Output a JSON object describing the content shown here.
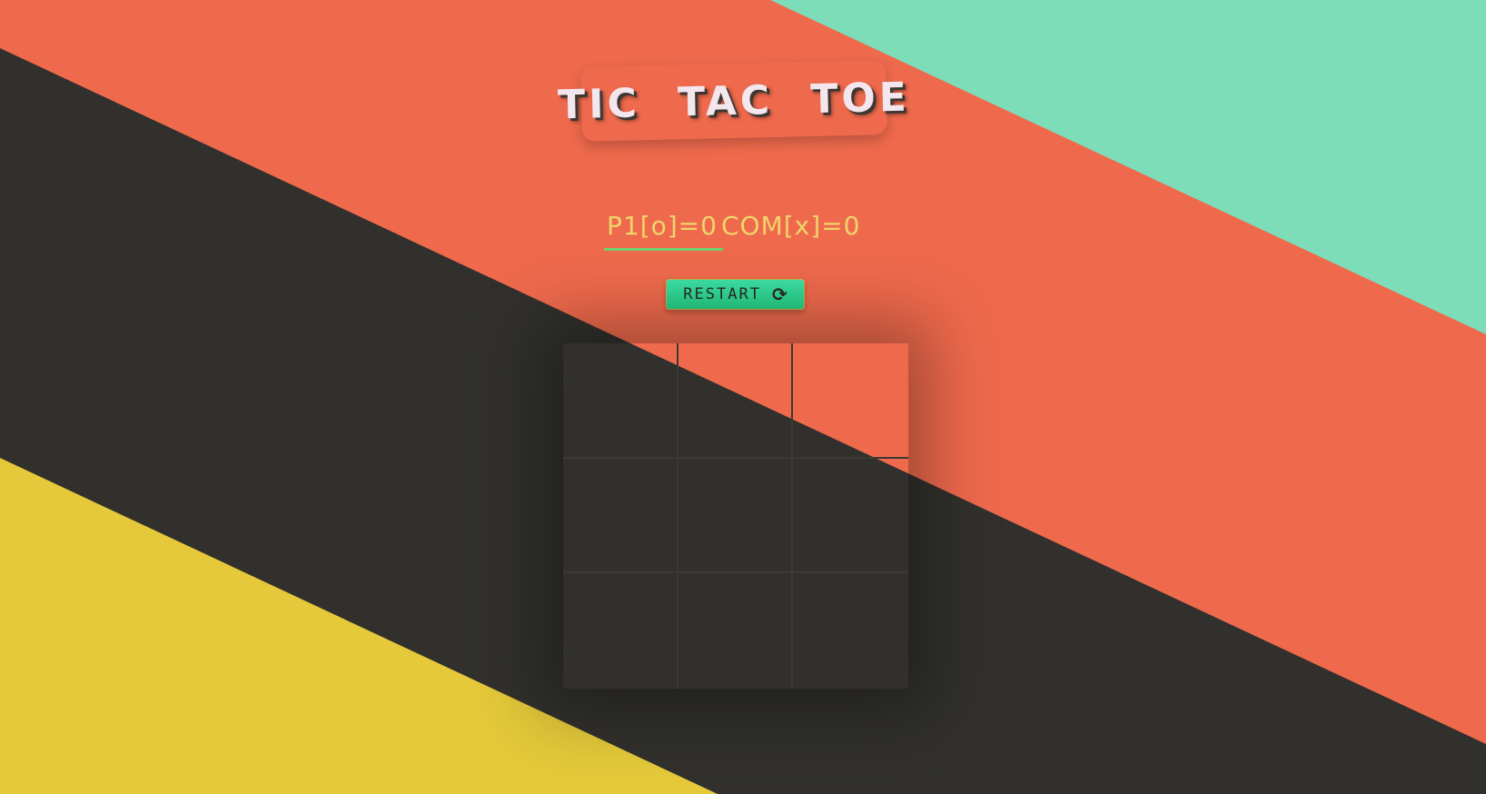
{
  "title": "TIC TAC TOE",
  "score": {
    "p1_label": "P1[o]=0",
    "com_label": "COM[x]=0"
  },
  "restart": {
    "label": "RESTART",
    "icon": "refresh-icon"
  },
  "board": {
    "cells": [
      "",
      "",
      "",
      "",
      "",
      "",
      "",
      "",
      ""
    ]
  },
  "colors": {
    "coral": "#ef6a4d",
    "mint": "#7dddb9",
    "charcoal": "#31302c",
    "yellow": "#e5c93a",
    "score_text": "#f0d46a",
    "underline_green": "#6fd36c",
    "button_green": "#2fd992"
  }
}
